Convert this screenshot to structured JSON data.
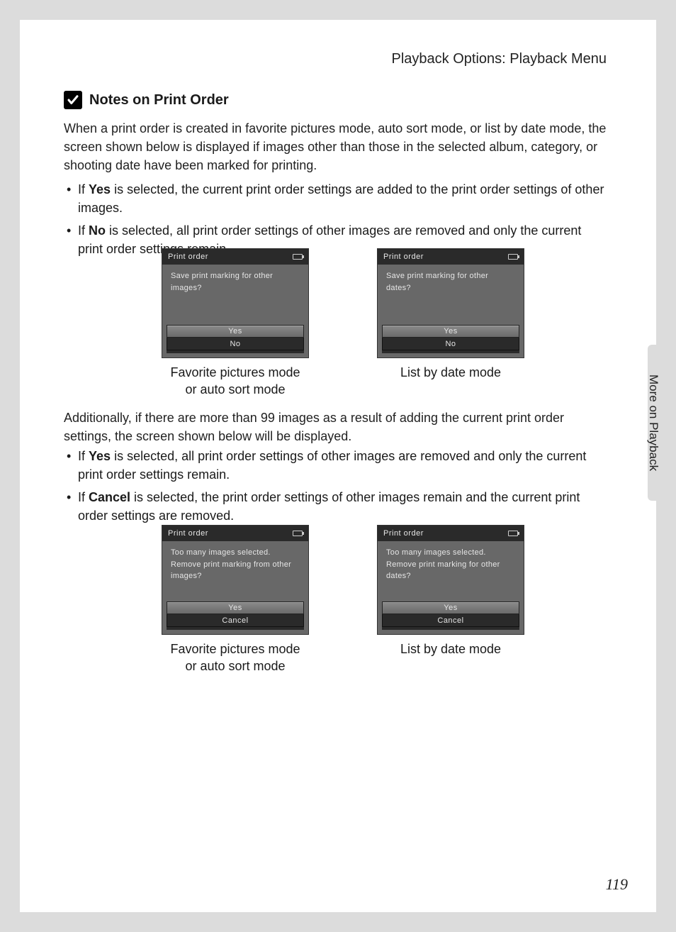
{
  "header": {
    "title": "Playback Options: Playback Menu"
  },
  "section": {
    "title": "Notes on Print Order"
  },
  "para1": "When a print order is created in favorite pictures mode, auto sort mode, or list by date mode, the screen shown below is displayed if images other than those in the selected album, category, or shooting date have been marked for printing.",
  "bullets1": {
    "b1a": "If ",
    "b1bold": "Yes",
    "b1b": " is selected, the current print order settings are added to the print order settings of other images.",
    "b2a": "If ",
    "b2bold": "No",
    "b2b": " is selected, all print order settings of other images are removed and only the current print order settings remain."
  },
  "para2": "Additionally, if there are more than 99 images as a result of adding the current print order settings, the screen shown below will be displayed.",
  "bullets2": {
    "b1a": "If ",
    "b1bold": "Yes",
    "b1b": " is selected, all print order settings of other images are removed and only the current print order settings remain.",
    "b2a": "If ",
    "b2bold": "Cancel",
    "b2b": " is selected, the print order settings of other images remain and the current print order settings are removed."
  },
  "screens": {
    "s1": {
      "header": "Print order",
      "prompt": "Save print marking for other images?",
      "opt1": "Yes",
      "opt2": "No",
      "caption_l1": "Favorite pictures mode",
      "caption_l2": "or auto sort mode"
    },
    "s2": {
      "header": "Print order",
      "prompt": "Save print marking for other dates?",
      "opt1": "Yes",
      "opt2": "No",
      "caption_l1": "List by date mode"
    },
    "s3": {
      "header": "Print order",
      "prompt": "Too many images selected. Remove print marking from other images?",
      "opt1": "Yes",
      "opt2": "Cancel",
      "caption_l1": "Favorite pictures mode",
      "caption_l2": "or auto sort mode"
    },
    "s4": {
      "header": "Print order",
      "prompt": "Too many images selected. Remove print marking for other dates?",
      "opt1": "Yes",
      "opt2": "Cancel",
      "caption_l1": "List by date mode"
    }
  },
  "side": {
    "label": "More on Playback"
  },
  "pageNumber": "119"
}
